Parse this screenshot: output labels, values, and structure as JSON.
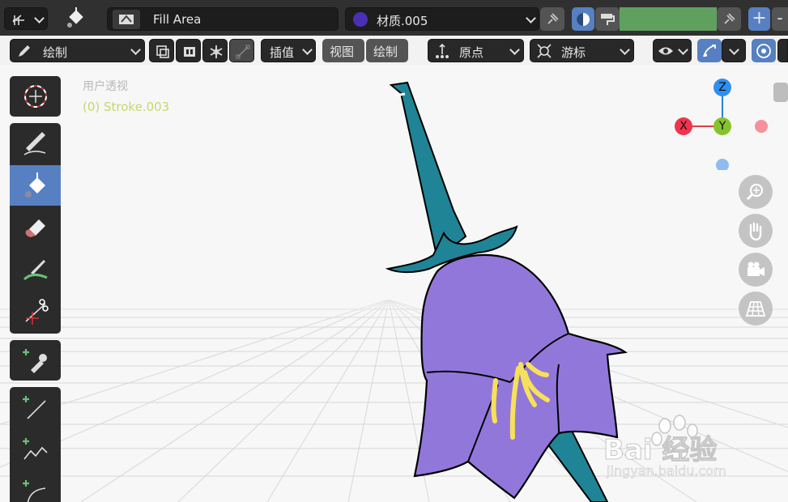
{
  "header": {
    "mode_icon": "grease-pencil-mode-icon",
    "fill_tool_icon": "fill-bucket-icon",
    "brush_name": "Fill Area",
    "material_name": "材质.005",
    "material_color": "#4a2fb5",
    "vertex_color": "#5fa05f",
    "add_label": "+",
    "remove_label": "-"
  },
  "toolbar2": {
    "draw_mode": "绘制",
    "interpolate": "插值",
    "view": "视图",
    "draw": "绘制",
    "origin": "原点",
    "cursor": "游标"
  },
  "viewport": {
    "view_label": "用户透视",
    "object_label": "(0) Stroke.003",
    "axes": {
      "x": "X",
      "y": "Y",
      "z": "Z"
    },
    "watermark_main": "Bai 经验",
    "watermark_sub": "jingyan.baidu.com"
  },
  "colors": {
    "accent": "#5680c2",
    "petal": "#9277db",
    "stem": "#1f8496",
    "stamen": "#f7e05a"
  }
}
